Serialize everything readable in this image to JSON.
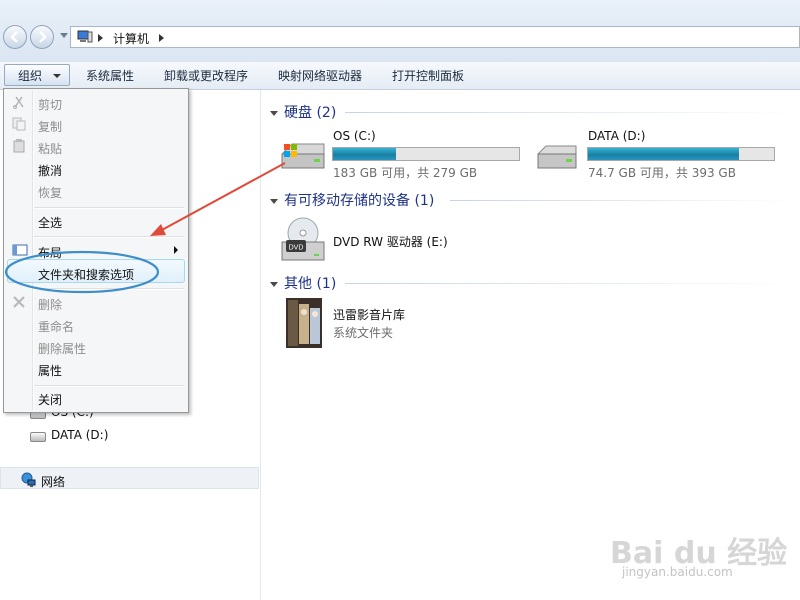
{
  "address": {
    "crumb": "计算机"
  },
  "toolbar": {
    "organize": "组织",
    "system_properties": "系统属性",
    "uninstall": "卸载或更改程序",
    "map_drive": "映射网络驱动器",
    "control_panel": "打开控制面板"
  },
  "menu": {
    "cut": "剪切",
    "copy": "复制",
    "paste": "粘贴",
    "undo": "撤消",
    "redo": "恢复",
    "select_all": "全选",
    "layout": "布局",
    "folder_options": "文件夹和搜索选项",
    "delete": "删除",
    "rename": "重命名",
    "remove_props": "删除属性",
    "properties": "属性",
    "close": "关闭"
  },
  "nav": {
    "os_drive": "OS (C:)",
    "data_drive": "DATA (D:)",
    "network": "网络"
  },
  "content": {
    "hdd_group": "硬盘 (2)",
    "removable_group": "有可移动存储的设备 (1)",
    "other_group": "其他 (1)",
    "drives": [
      {
        "name": "OS (C:)",
        "free": "183 GB 可用，共 279 GB",
        "used_fraction": 0.34
      },
      {
        "name": "DATA (D:)",
        "free": "74.7 GB 可用，共 393 GB",
        "used_fraction": 0.81
      }
    ],
    "dvd": {
      "name": "DVD RW 驱动器 (E:)",
      "icon_label": "DVD"
    },
    "library": {
      "name": "迅雷影音片库",
      "type": "系统文件夹"
    }
  },
  "watermark": {
    "brand": "Bai du 经验",
    "url": "jingyan.baidu.com"
  },
  "colors": {
    "accent": "#1e3287",
    "annotation": "#e04a3b",
    "highlight_ellipse": "#3d8ec9"
  }
}
